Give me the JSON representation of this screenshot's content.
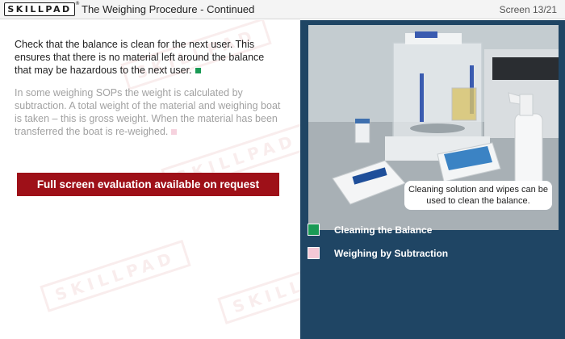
{
  "header": {
    "logo_text": "SKILLPAD",
    "title": "The Weighing Procedure - Continued",
    "screen_counter": "Screen 13/21"
  },
  "content": {
    "paragraph1": "Check that the balance is clean for the next user. This ensures that there is no material left around the balance that may be hazardous to the next user.",
    "paragraph2": "In some weighing SOPs the weight is calculated by subtraction. A total weight of the material and weighing boat is taken – this is gross weight. When the material has been transferred the boat is re-weighed.",
    "evaluation_button": "Full screen evaluation available on request"
  },
  "image": {
    "caption": "Cleaning solution and wipes can be used to clean the balance."
  },
  "legend": [
    {
      "label": "Cleaning the Balance",
      "color": "#1a9a55"
    },
    {
      "label": "Weighing by Subtraction",
      "color": "#f4c8d6"
    }
  ],
  "colors": {
    "header_bg": "#f4f4f4",
    "right_panel_bg": "#1f4564",
    "button_bg": "#9e1018"
  }
}
